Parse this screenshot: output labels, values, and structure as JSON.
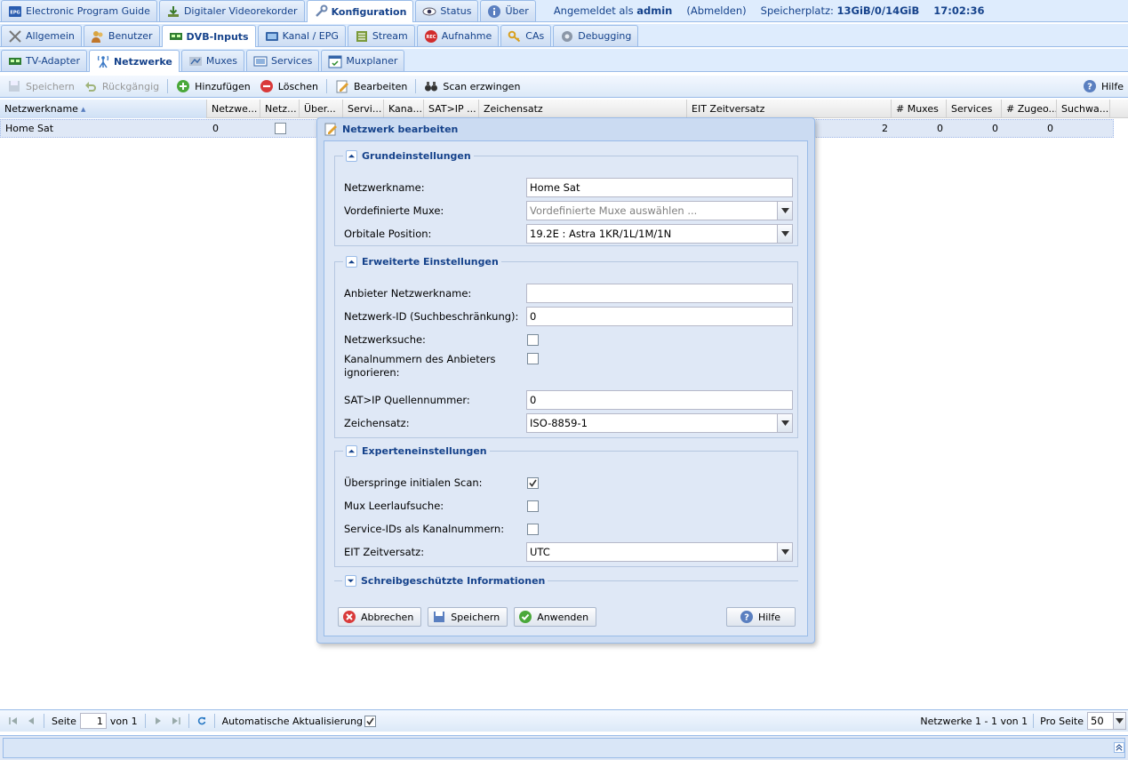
{
  "top_tabs": [
    {
      "label": "Electronic Program Guide",
      "icon": "epg-icon"
    },
    {
      "label": "Digitaler Videorekorder",
      "icon": "download-icon"
    },
    {
      "label": "Konfiguration",
      "icon": "wrench-icon"
    },
    {
      "label": "Status",
      "icon": "eye-icon"
    },
    {
      "label": "Über",
      "icon": "info-icon"
    }
  ],
  "header_info": {
    "logged_in_prefix": "Angemeldet als",
    "user": "admin",
    "logout": "(Abmelden)",
    "storage_prefix": "Speicherplatz:",
    "storage_value": "13GiB/0/14GiB",
    "time": "17:02:36"
  },
  "config_tabs": [
    {
      "label": "Allgemein",
      "icon": "tools-icon"
    },
    {
      "label": "Benutzer",
      "icon": "users-icon"
    },
    {
      "label": "DVB-Inputs",
      "icon": "card-icon"
    },
    {
      "label": "Kanal / EPG",
      "icon": "tv-icon"
    },
    {
      "label": "Stream",
      "icon": "stream-icon"
    },
    {
      "label": "Aufnahme",
      "icon": "rec-icon"
    },
    {
      "label": "CAs",
      "icon": "key-icon"
    },
    {
      "label": "Debugging",
      "icon": "bug-icon"
    }
  ],
  "dvb_tabs": [
    {
      "label": "TV-Adapter",
      "icon": "card-icon"
    },
    {
      "label": "Netzwerke",
      "icon": "antenna-icon"
    },
    {
      "label": "Muxes",
      "icon": "satellite-icon"
    },
    {
      "label": "Services",
      "icon": "screen-icon"
    },
    {
      "label": "Muxplaner",
      "icon": "calendar-icon"
    }
  ],
  "toolbar": {
    "save": "Speichern",
    "undo": "Rückgängig",
    "add": "Hinzufügen",
    "delete": "Löschen",
    "edit": "Bearbeiten",
    "force_scan": "Scan erzwingen",
    "help": "Hilfe"
  },
  "grid": {
    "columns": [
      "Netzwerkname",
      "Netzwe...",
      "Netz...",
      "Über...",
      "Servi...",
      "Kana...",
      "SAT>IP ...",
      "Zeichensatz",
      "EIT Zeitversatz",
      "# Muxes",
      "Services",
      "# Zugeo...",
      "Suchwa..."
    ],
    "row": {
      "name": "Home Sat",
      "c2": "0",
      "muxes": "2",
      "services": "0",
      "assigned": "0",
      "queue": "0"
    }
  },
  "dialog": {
    "title": "Netzwerk bearbeiten",
    "sections": {
      "basic": "Grundeinstellungen",
      "advanced": "Erweiterte Einstellungen",
      "expert": "Experteneinstellungen",
      "readonly": "Schreibgeschützte Informationen"
    },
    "fields": {
      "network_name_label": "Netzwerkname:",
      "network_name_value": "Home Sat",
      "predef_label": "Vordefinierte Muxe:",
      "predef_placeholder": "Vordefinierte Muxe auswählen ...",
      "orbital_label": "Orbitale Position:",
      "orbital_value": "19.2E : Astra 1KR/1L/1M/1N",
      "provider_name_label": "Anbieter Netzwerkname:",
      "provider_name_value": "",
      "netid_label": "Netzwerk-ID (Suchbeschränkung):",
      "netid_value": "0",
      "netsearch_label": "Netzwerksuche:",
      "ignore_lcn_label": "Kanalnummern des Anbieters ignorieren:",
      "satip_label": "SAT>IP Quellennummer:",
      "satip_value": "0",
      "charset_label": "Zeichensatz:",
      "charset_value": "ISO-8859-1",
      "skip_scan_label": "Überspringe initialen Scan:",
      "idle_scan_label": "Mux Leerlaufsuche:",
      "sid_lcn_label": "Service-IDs als Kanalnummern:",
      "eit_label": "EIT Zeitversatz:",
      "eit_value": "UTC"
    },
    "checkboxes": {
      "netsearch": false,
      "ignore_lcn": false,
      "skip_scan": true,
      "idle_scan": false,
      "sid_lcn": false
    },
    "buttons": {
      "cancel": "Abbrechen",
      "save": "Speichern",
      "apply": "Anwenden",
      "help": "Hilfe"
    }
  },
  "paging": {
    "page_label": "Seite",
    "page": "1",
    "of_label": "von 1",
    "auto_refresh": "Automatische Aktualisierung",
    "auto_refresh_checked": true,
    "summary": "Netzwerke 1 - 1 von 1",
    "per_page_label": "Pro Seite",
    "per_page": "50"
  }
}
